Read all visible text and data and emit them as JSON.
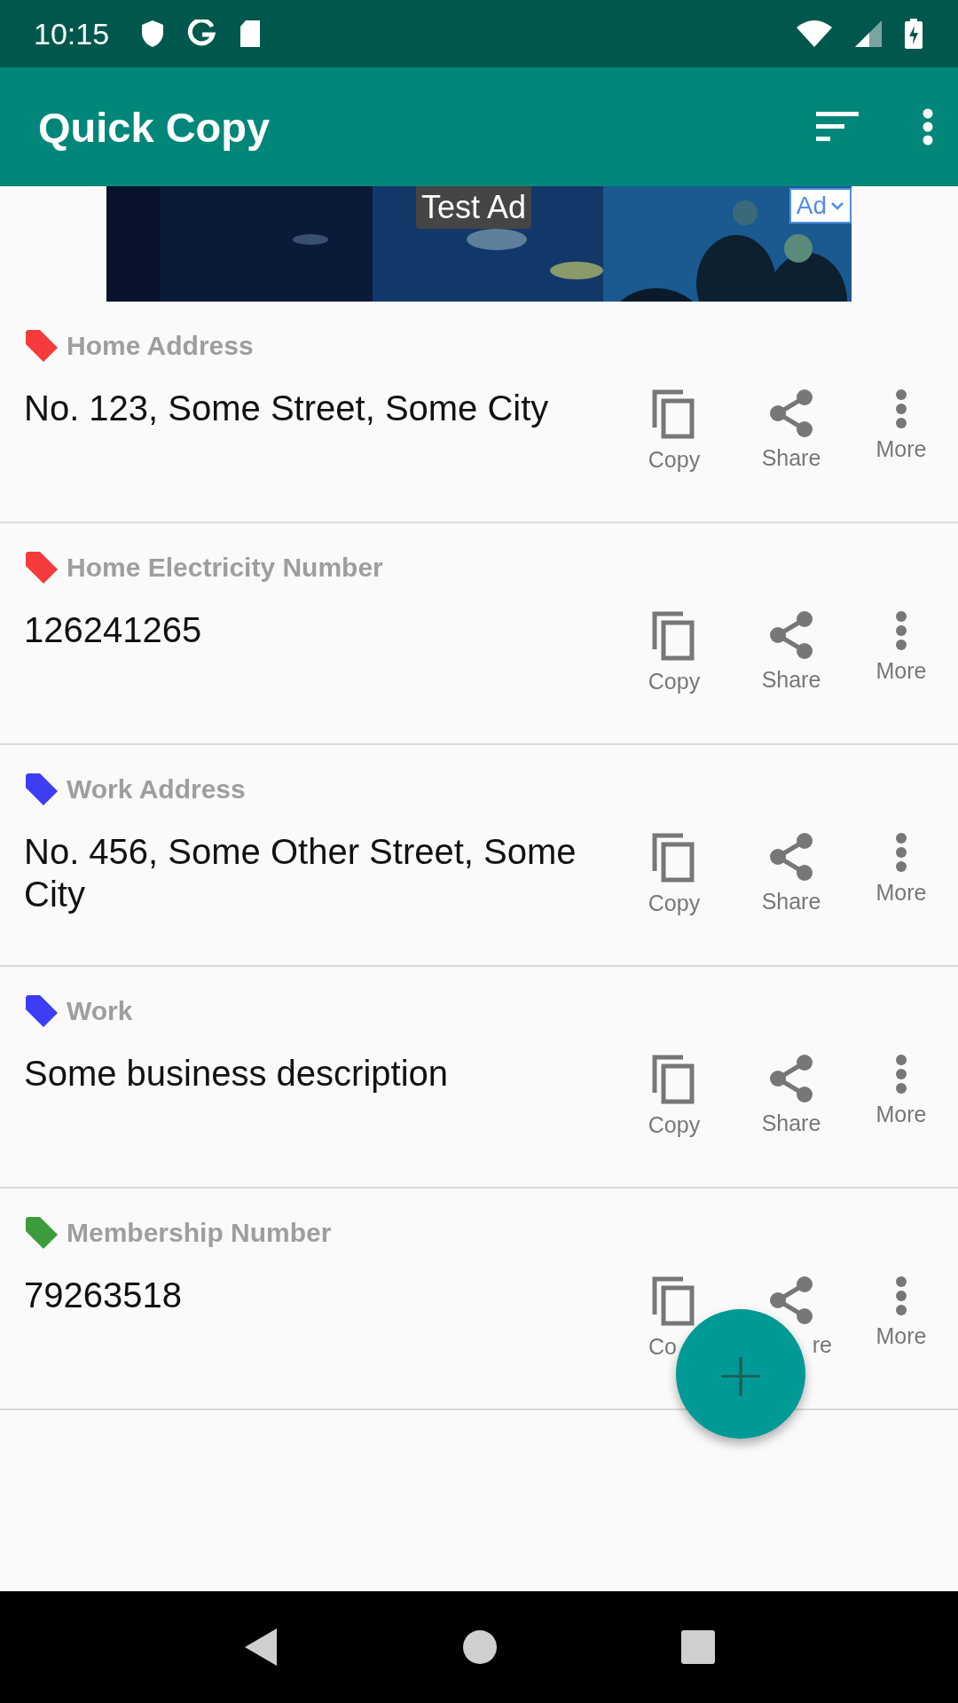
{
  "status_bar": {
    "time": "10:15"
  },
  "app_bar": {
    "title": "Quick Copy"
  },
  "ad": {
    "label": "Test Ad",
    "badge": "Ad"
  },
  "items": [
    {
      "tag": "Home Address",
      "color": "#f53b3b",
      "value": "No. 123, Some Street, Some City",
      "actions": [
        {
          "kind": "copy",
          "label": "Copy"
        },
        {
          "kind": "share",
          "label": "Share"
        },
        {
          "kind": "more",
          "label": "More"
        }
      ]
    },
    {
      "tag": "Home Electricity Number",
      "color": "#f53b3b",
      "value": "126241265",
      "actions": [
        {
          "kind": "copy",
          "label": "Copy"
        },
        {
          "kind": "share",
          "label": "Share"
        },
        {
          "kind": "more",
          "label": "More"
        }
      ]
    },
    {
      "tag": "Work Address",
      "color": "#3d3df5",
      "value": "No. 456, Some Other Street, Some City",
      "actions": [
        {
          "kind": "copy",
          "label": "Copy"
        },
        {
          "kind": "share",
          "label": "Share"
        },
        {
          "kind": "more",
          "label": "More"
        }
      ]
    },
    {
      "tag": "Work",
      "color": "#3d3df5",
      "value": "Some business description",
      "actions": [
        {
          "kind": "copy",
          "label": "Copy"
        },
        {
          "kind": "share",
          "label": "Share"
        },
        {
          "kind": "more",
          "label": "More"
        }
      ]
    },
    {
      "tag": "Membership Number",
      "color": "#3c9c3c",
      "value": "79263518",
      "actions": [
        {
          "kind": "copy",
          "label": "Co",
          "end_hidden": true
        },
        {
          "kind": "share",
          "label": "re",
          "start_hidden": true
        },
        {
          "kind": "more",
          "label": "More"
        }
      ]
    }
  ],
  "fab": {
    "label": "+"
  }
}
